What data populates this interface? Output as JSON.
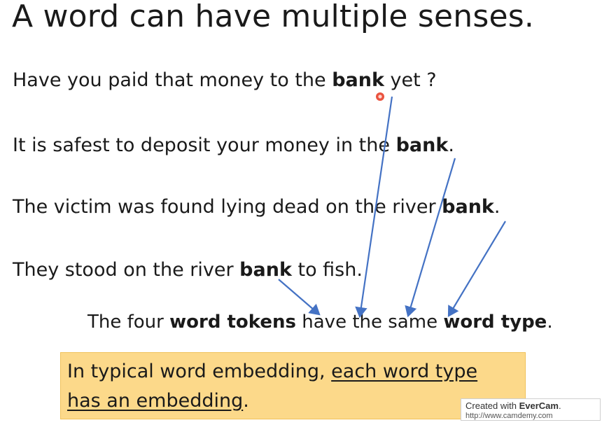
{
  "title": "A word can have multiple senses.",
  "sentences": [
    {
      "before": "Have you paid that money to the ",
      "bold": "bank",
      "after": " yet ?"
    },
    {
      "before": "It is safest to deposit your money in the ",
      "bold": "bank",
      "after": "."
    },
    {
      "before": "The victim was found lying dead on the river ",
      "bold": "bank",
      "after": "."
    },
    {
      "before": "They stood on the river ",
      "bold": "bank",
      "after": " to fish."
    }
  ],
  "conclusion": {
    "part1": "The four ",
    "bold1": "word tokens",
    "part2": " have the same ",
    "bold2": "word type",
    "part3": "."
  },
  "callout": {
    "prefix": "In typical word embedding, ",
    "underlined1": "each word type",
    "underlined2": "has an embedding",
    "suffix": "."
  },
  "watermark": {
    "prefix": "Created with ",
    "brand": "EverCam",
    "suffix": ".",
    "url": "http://www.camdemy.com"
  },
  "colors": {
    "arrow": "#4472c4",
    "callout_bg": "#fcd98a",
    "cursor": "#e8402a"
  }
}
